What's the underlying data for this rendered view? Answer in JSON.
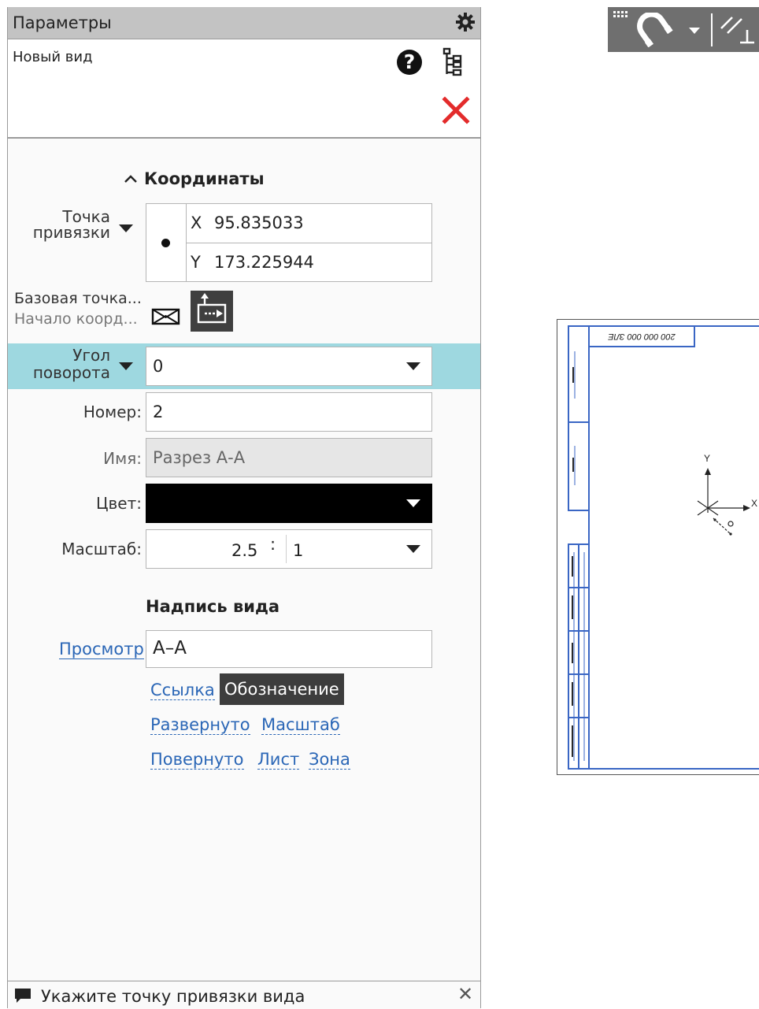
{
  "panel": {
    "title": "Параметры",
    "view_name": "Новый вид"
  },
  "coordinates": {
    "section_title": "Координаты",
    "anchor_label_1": "Точка",
    "anchor_label_2": "привязки",
    "x_label": "X",
    "x_value": "95.835033",
    "y_label": "Y",
    "y_value": "173.225944",
    "base_point_label": "Базовая точка...",
    "origin_label": "Начало коорд..."
  },
  "fields": {
    "angle_label_1": "Угол",
    "angle_label_2": "поворота",
    "angle_value": "0",
    "number_label": "Номер:",
    "number_value": "2",
    "name_label": "Имя:",
    "name_value": "Разрез А-А",
    "color_label": "Цвет:",
    "color_value": "#000000",
    "scale_label": "Масштаб:",
    "scale_num": "2.5",
    "scale_sep": ":",
    "scale_den": "1"
  },
  "inscription": {
    "section_title": "Надпись вида",
    "preview_link": "Просмотр",
    "preview_value": "А–А",
    "links": {
      "link": "Ссылка",
      "designation": "Обозначение",
      "expanded": "Развернуто",
      "scale": "Масштаб",
      "rotated": "Повернуто",
      "sheet": "Лист",
      "zone": "Зона"
    }
  },
  "hint": {
    "text": "Укажите точку привязки вида"
  },
  "drawing": {
    "stamp_text": "200 000 000 ЗЛЕ",
    "axis_y": "Y",
    "axis_x": "X"
  },
  "colors": {
    "accent_row": "#9ed8e0",
    "link": "#2a66b6",
    "close_red": "#e32b2b",
    "frame_blue": "#3a66c4"
  }
}
